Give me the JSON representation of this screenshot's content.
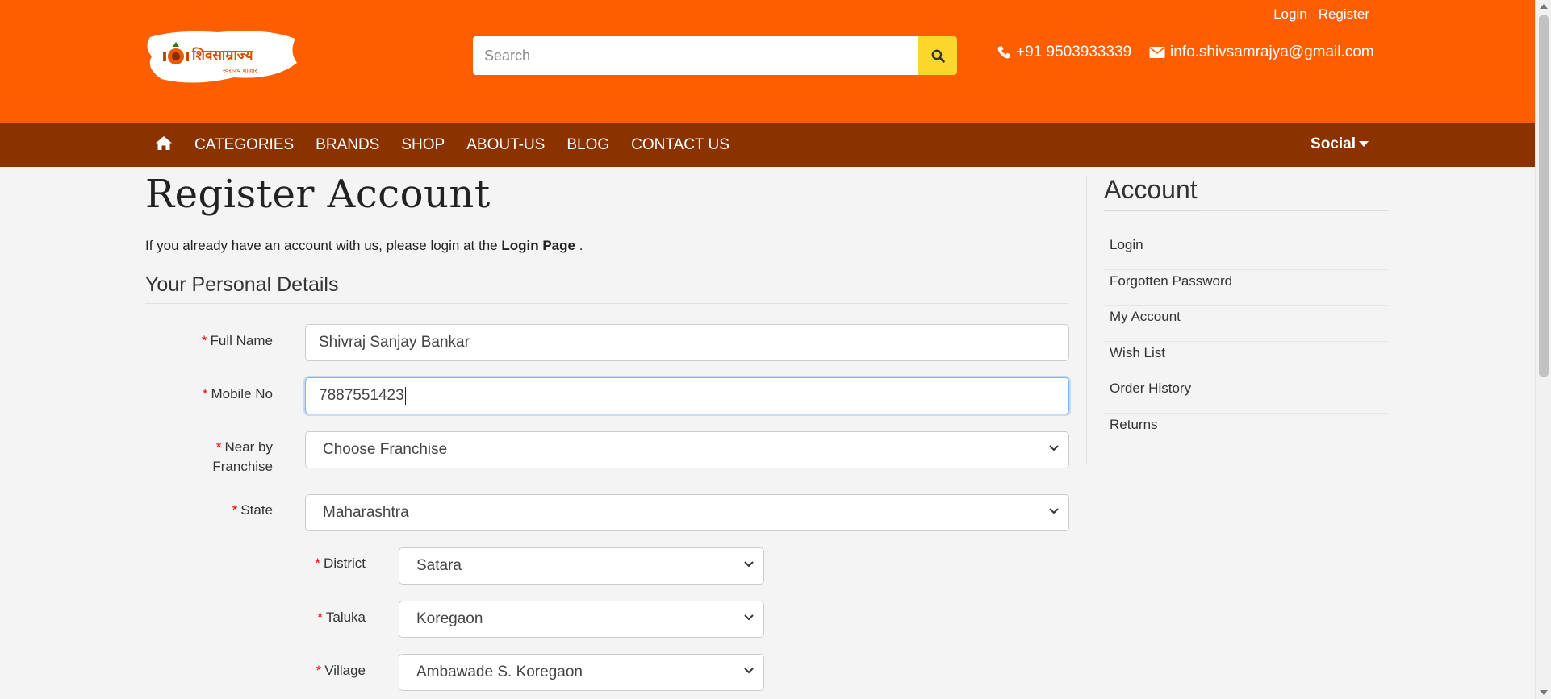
{
  "header": {
    "top_links": [
      "Login",
      "Register"
    ],
    "search_placeholder": "Search",
    "phone": "+91 9503933339",
    "email": "info.shivsamrajya@gmail.com",
    "logo_text": "शिवसाम्राज्य",
    "logo_subtext": "स्वराज्य बाजार"
  },
  "nav": {
    "items": [
      "CATEGORIES",
      "BRANDS",
      "SHOP",
      "ABOUT-US",
      "BLOG",
      "CONTACT US"
    ],
    "social": "Social"
  },
  "page": {
    "title": "Register Account",
    "intro_prefix": "If you already have an account with us, please login at the ",
    "intro_link": "Login Page",
    "intro_suffix": " .",
    "section": "Your Personal Details"
  },
  "form": {
    "full_name_label": "Full Name",
    "full_name_value": "Shivraj Sanjay Bankar",
    "mobile_label": "Mobile No",
    "mobile_value": "7887551423",
    "franchise_label_1": "Near by",
    "franchise_label_2": "Franchise",
    "franchise_value": "Choose Franchise",
    "state_label": "State",
    "state_value": "Maharashtra",
    "district_label": "District",
    "district_value": "Satara",
    "taluka_label": "Taluka",
    "taluka_value": "Koregaon",
    "village_label": "Village",
    "village_value": "Ambawade S. Koregaon",
    "required_mark": "*"
  },
  "sidebar": {
    "title": "Account",
    "items": [
      "Login",
      "Forgotten Password",
      "My Account",
      "Wish List",
      "Order History",
      "Returns"
    ]
  },
  "colors": {
    "header_bg": "#ff5e00",
    "nav_bg": "#8a3300",
    "search_button": "#fcd62b"
  }
}
